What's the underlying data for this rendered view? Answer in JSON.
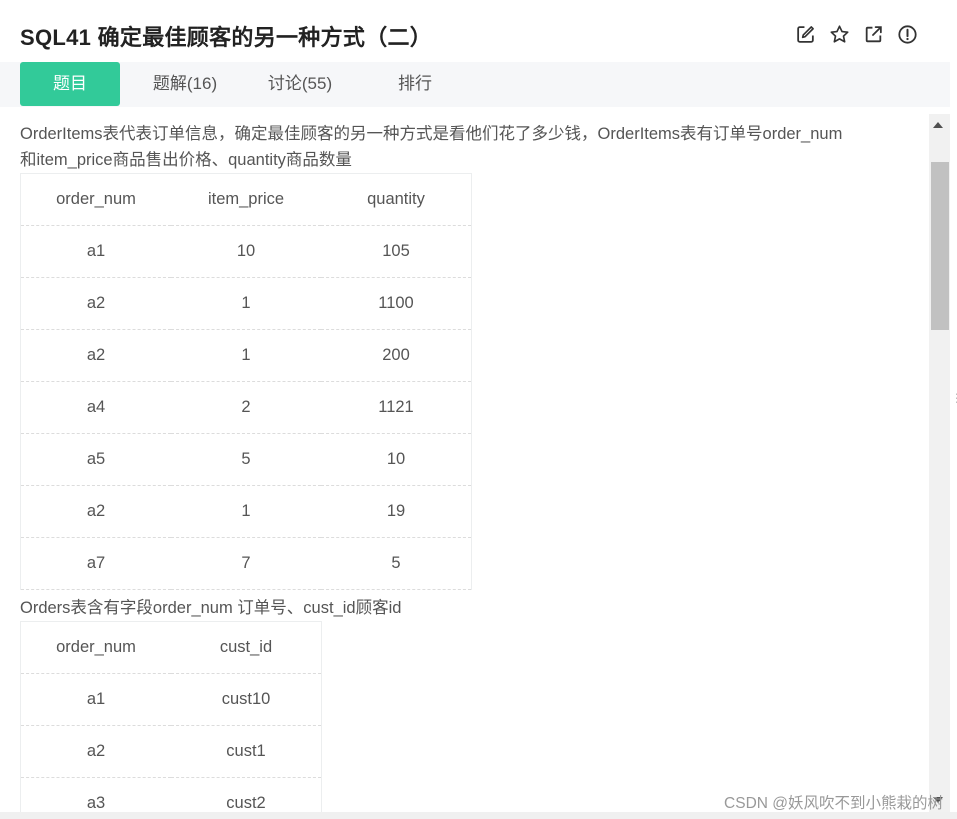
{
  "header": {
    "title": "SQL41  确定最佳顾客的另一种方式（二）",
    "icons": [
      "edit-icon",
      "star-icon",
      "external-link-icon",
      "info-icon"
    ]
  },
  "tabs": [
    {
      "label": "题目",
      "active": true
    },
    {
      "label": "题解(16)",
      "active": false
    },
    {
      "label": "讨论(55)",
      "active": false
    },
    {
      "label": "排行",
      "active": false
    }
  ],
  "content": {
    "desc1_line1": "OrderItems表代表订单信息，确定最佳顾客的另一种方式是看他们花了多少钱，OrderItems表有订单号order_num",
    "desc1_line2": "和item_price商品售出价格、quantity商品数量",
    "table1": {
      "headers": [
        "order_num",
        "item_price",
        "quantity"
      ],
      "rows": [
        [
          "a1",
          "10",
          "105"
        ],
        [
          "a2",
          "1",
          "1100"
        ],
        [
          "a2",
          "1",
          "200"
        ],
        [
          "a4",
          "2",
          "1121"
        ],
        [
          "a5",
          "5",
          "10"
        ],
        [
          "a2",
          "1",
          "19"
        ],
        [
          "a7",
          "7",
          "5"
        ]
      ]
    },
    "desc2": "Orders表含有字段order_num 订单号、cust_id顾客id",
    "table2": {
      "headers": [
        "order_num",
        "cust_id"
      ],
      "rows": [
        [
          "a1",
          "cust10"
        ],
        [
          "a2",
          "cust1"
        ],
        [
          "a3",
          "cust2"
        ]
      ]
    }
  },
  "watermark": "CSDN @妖风吹不到小熊栽的树",
  "colors": {
    "accent": "#32ca99",
    "tab_bar_bg": "#f6f7f9",
    "text": "#555555"
  }
}
